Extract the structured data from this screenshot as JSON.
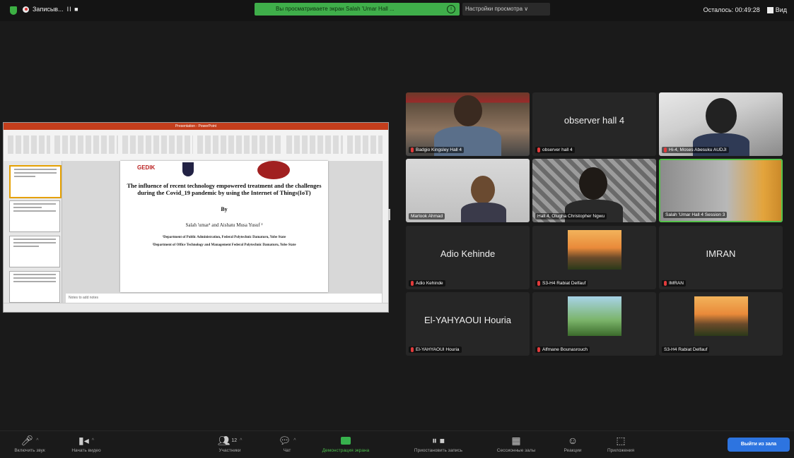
{
  "top_bar": {
    "recording_label": "Записыв...",
    "recording_controls": "II ■",
    "share_banner": "Вы просматриваете экран Salah 'Umar Hall ...",
    "view_options": "Настройки просмотра ∨",
    "time_left": "Осталось: 00:49:28",
    "view_label": "Вид"
  },
  "presentation": {
    "window_title": "Presentation - PowerPoint",
    "slide_title": "The influence of recent technology empowered treatment and the challenges during the Covid_19 pandemic by using the Internet of Things(IoT)",
    "slide_by": "By",
    "slide_authors": "Salah 'umar¹ and Aishatu Musa Yusuf ²",
    "aff1": "¹Department of Public Administration, Federal Polytechnic Damaturu, Yobe State",
    "aff2": "²Department of Office Technology and Management Federal Polytechnic Damaturu, Yobe State",
    "logo_text": "GEDIK",
    "notes_placeholder": "Notes to add notes"
  },
  "participants": [
    {
      "display": "",
      "name": "Badgio Kingsley Hall 4",
      "muted": true
    },
    {
      "display": "observer hall 4",
      "name": "observer hall 4",
      "muted": true
    },
    {
      "display": "",
      "name": "Hi-4, Moses Abesuku AUDJI",
      "muted": true
    },
    {
      "display": "",
      "name": "Marlook Ahmad",
      "muted": false
    },
    {
      "display": "",
      "name": "Hall 4, Olugha Christopher Ngwu",
      "muted": false
    },
    {
      "display": "",
      "name": "Salah 'Umar Hall 4 Session 3",
      "muted": false
    },
    {
      "display": "Adio Kehinde",
      "name": "Adio Kehinde",
      "muted": true
    },
    {
      "display": "",
      "name": "S3-H4 Rabiat Delfauf",
      "muted": true
    },
    {
      "display": "IMRAN",
      "name": "IMRAN",
      "muted": true
    },
    {
      "display": "El-YAHYAOUI Houria",
      "name": "El-YAHYAOUI Houria",
      "muted": true
    },
    {
      "display": "",
      "name": "Alfmane Bounasrouch",
      "muted": true
    },
    {
      "display": "",
      "name": "S3-H4 Rabiat Delfauf",
      "muted": false
    }
  ],
  "toolbar": {
    "audio": "Включить звук",
    "video": "Начать видео",
    "participants": "Участники",
    "participants_count": "12",
    "chat": "Чат",
    "share": "Демонстрация экрана",
    "pause_share": "Приостановить запись",
    "breakout": "Сессионные залы",
    "reactions": "Реакции",
    "apps": "Приложения",
    "leave": "Выйти из зала"
  }
}
